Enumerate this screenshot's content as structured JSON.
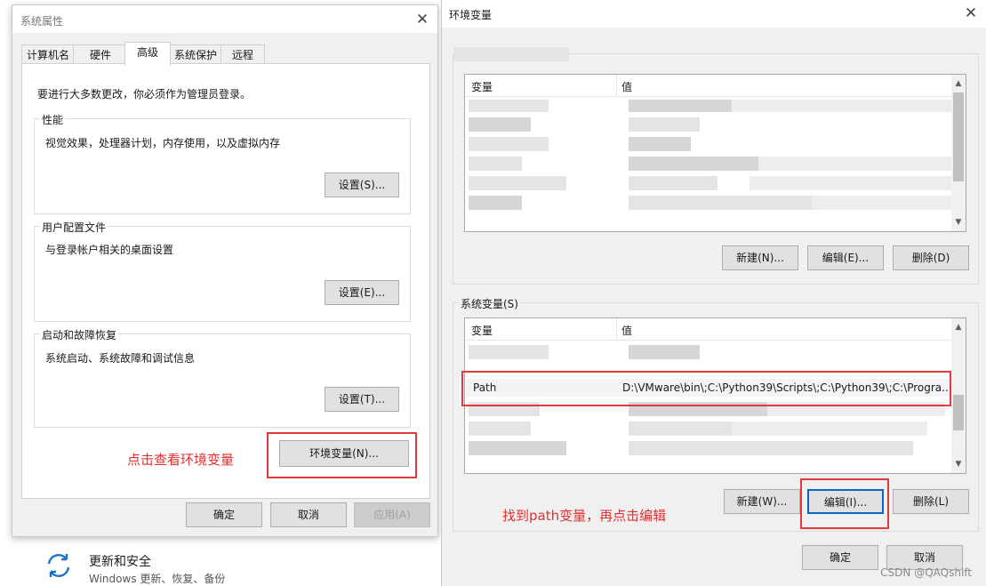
{
  "system_properties": {
    "title": "系统属性",
    "tabs": [
      {
        "label": "计算机名",
        "active": false
      },
      {
        "label": "硬件",
        "active": false
      },
      {
        "label": "高级",
        "active": true
      },
      {
        "label": "系统保护",
        "active": false
      },
      {
        "label": "远程",
        "active": false
      }
    ],
    "admin_note": "要进行大多数更改，你必须作为管理员登录。",
    "performance": {
      "title": "性能",
      "desc": "视觉效果，处理器计划，内存使用，以及虚拟内存",
      "button": "设置(S)..."
    },
    "user_profiles": {
      "title": "用户配置文件",
      "desc": "与登录帐户相关的桌面设置",
      "button": "设置(E)..."
    },
    "startup_recovery": {
      "title": "启动和故障恢复",
      "desc": "系统启动、系统故障和调试信息",
      "button": "设置(T)..."
    },
    "env_button": "环境变量(N)...",
    "annotation": "点击查看环境变量",
    "ok": "确定",
    "cancel": "取消",
    "apply": "应用(A)"
  },
  "environment_variables": {
    "title": "环境变量",
    "user_vars": {
      "columns": {
        "name": "变量",
        "value": "值"
      },
      "new_button": "新建(N)...",
      "edit_button": "编辑(E)...",
      "delete_button": "删除(D)"
    },
    "system_vars": {
      "label": "系统变量(S)",
      "columns": {
        "name": "变量",
        "value": "值"
      },
      "highlight_row": {
        "name": "Path",
        "value": "D:\\VMware\\bin\\;C:\\Python39\\Scripts\\;C:\\Python39\\;C:\\Progra..."
      },
      "new_button": "新建(W)...",
      "edit_button": "编辑(I)...",
      "delete_button": "删除(L)"
    },
    "annotation": "找到path变量，再点击编辑",
    "ok": "确定",
    "cancel": "取消"
  },
  "settings_item": {
    "title": "更新和安全",
    "subtitle": "Windows 更新、恢复、备份",
    "icon": "sync-icon"
  },
  "watermark": "CSDN @QAQshift",
  "colors": {
    "annotation_red": "#e03030",
    "dialog_bg": "#f0f0f0"
  }
}
